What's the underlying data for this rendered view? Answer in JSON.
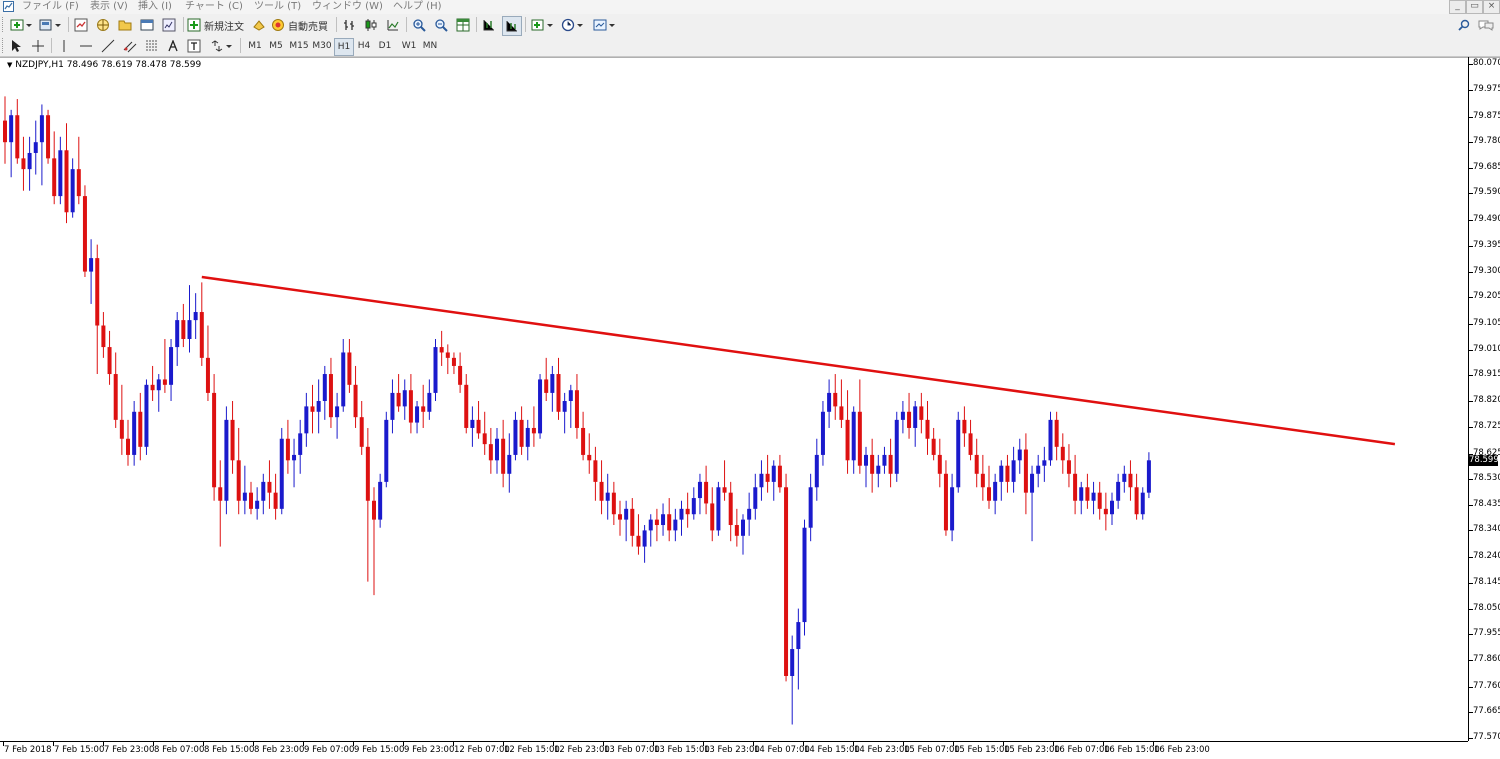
{
  "menu": {
    "items": [
      "ファイル (F)",
      "表示 (V)",
      "挿入 (I)",
      "チャート (C)",
      "ツール (T)",
      "ウィンドウ (W)",
      "ヘルプ (H)"
    ]
  },
  "toolbar": {
    "new_order_label": "新規注文",
    "auto_trading_label": "自動売買"
  },
  "timeframes": [
    "M1",
    "M5",
    "M15",
    "M30",
    "H1",
    "H4",
    "D1",
    "W1",
    "MN"
  ],
  "active_timeframe": "H1",
  "chart": {
    "symbol_info": "NZDJPY,H1  78.496 78.619 78.478 78.599",
    "current_price": "78.599",
    "price_levels": [
      "80.070",
      "79.975",
      "79.875",
      "79.780",
      "79.685",
      "79.590",
      "79.490",
      "79.395",
      "79.300",
      "79.205",
      "79.105",
      "79.010",
      "78.915",
      "78.820",
      "78.725",
      "78.625",
      "78.530",
      "78.435",
      "78.340",
      "78.240",
      "78.145",
      "78.050",
      "77.955",
      "77.860",
      "77.760",
      "77.665",
      "77.570"
    ],
    "time_labels": [
      "7 Feb 2018",
      "7 Feb 15:00",
      "7 Feb 23:00",
      "8 Feb 07:00",
      "8 Feb 15:00",
      "8 Feb 23:00",
      "9 Feb 07:00",
      "9 Feb 15:00",
      "9 Feb 23:00",
      "12 Feb 07:00",
      "12 Feb 15:00",
      "12 Feb 23:00",
      "13 Feb 07:00",
      "13 Feb 15:00",
      "13 Feb 23:00",
      "14 Feb 07:00",
      "14 Feb 15:00",
      "14 Feb 23:00",
      "15 Feb 07:00",
      "15 Feb 15:00",
      "15 Feb 23:00",
      "16 Feb 07:00",
      "16 Feb 15:00",
      "16 Feb 23:00"
    ],
    "colors": {
      "bull": "#1a1acc",
      "bear": "#dd1111",
      "trendline": "#e01010",
      "doji": "#22aa22"
    },
    "trendline": {
      "start": {
        "bar": 32,
        "price": 79.28
      },
      "end": {
        "bar": 226,
        "price": 78.66
      }
    },
    "ohlc": [
      [
        79.86,
        79.95,
        79.7,
        79.78
      ],
      [
        79.78,
        79.9,
        79.65,
        79.88
      ],
      [
        79.88,
        79.94,
        79.7,
        79.72
      ],
      [
        79.72,
        79.8,
        79.6,
        79.68
      ],
      [
        79.68,
        79.8,
        79.6,
        79.74
      ],
      [
        79.74,
        79.86,
        79.66,
        79.78
      ],
      [
        79.78,
        79.92,
        79.62,
        79.88
      ],
      [
        79.88,
        79.9,
        79.7,
        79.72
      ],
      [
        79.72,
        79.82,
        79.55,
        79.58
      ],
      [
        79.58,
        79.8,
        79.55,
        79.75
      ],
      [
        79.75,
        79.85,
        79.48,
        79.52
      ],
      [
        79.52,
        79.72,
        79.5,
        79.68
      ],
      [
        79.68,
        79.8,
        79.55,
        79.58
      ],
      [
        79.58,
        79.62,
        79.28,
        79.3
      ],
      [
        79.3,
        79.42,
        79.18,
        79.35
      ],
      [
        79.35,
        79.4,
        78.92,
        79.1
      ],
      [
        79.1,
        79.15,
        78.98,
        79.02
      ],
      [
        79.02,
        79.08,
        78.88,
        78.92
      ],
      [
        78.92,
        79.0,
        78.72,
        78.75
      ],
      [
        78.75,
        78.88,
        78.62,
        78.68
      ],
      [
        78.68,
        78.75,
        78.58,
        78.62
      ],
      [
        78.62,
        78.82,
        78.58,
        78.78
      ],
      [
        78.78,
        78.85,
        78.6,
        78.65
      ],
      [
        78.65,
        78.9,
        78.62,
        78.88
      ],
      [
        78.88,
        78.95,
        78.82,
        78.86
      ],
      [
        78.86,
        78.92,
        78.78,
        78.9
      ],
      [
        78.9,
        79.05,
        78.85,
        78.88
      ],
      [
        78.88,
        79.05,
        78.82,
        79.02
      ],
      [
        79.02,
        79.15,
        78.95,
        79.12
      ],
      [
        79.12,
        79.18,
        79.02,
        79.05
      ],
      [
        79.05,
        79.25,
        79.0,
        79.12
      ],
      [
        79.12,
        79.22,
        79.05,
        79.15
      ],
      [
        79.15,
        79.26,
        78.95,
        78.98
      ],
      [
        78.98,
        79.1,
        78.82,
        78.85
      ],
      [
        78.85,
        78.92,
        78.45,
        78.5
      ],
      [
        78.5,
        78.6,
        78.28,
        78.45
      ],
      [
        78.45,
        78.8,
        78.4,
        78.75
      ],
      [
        78.75,
        78.82,
        78.55,
        78.6
      ],
      [
        78.6,
        78.72,
        78.4,
        78.45
      ],
      [
        78.45,
        78.58,
        78.4,
        78.48
      ],
      [
        78.48,
        78.52,
        78.4,
        78.42
      ],
      [
        78.42,
        78.5,
        78.38,
        78.45
      ],
      [
        78.45,
        78.55,
        78.4,
        78.52
      ],
      [
        78.52,
        78.6,
        78.42,
        78.48
      ],
      [
        78.48,
        78.55,
        78.38,
        78.42
      ],
      [
        78.42,
        78.72,
        78.4,
        78.68
      ],
      [
        78.68,
        78.75,
        78.55,
        78.6
      ],
      [
        78.6,
        78.68,
        78.5,
        78.62
      ],
      [
        78.62,
        78.75,
        78.55,
        78.7
      ],
      [
        78.7,
        78.85,
        78.65,
        78.8
      ],
      [
        78.8,
        78.88,
        78.7,
        78.78
      ],
      [
        78.78,
        78.9,
        78.7,
        78.82
      ],
      [
        78.82,
        78.95,
        78.75,
        78.92
      ],
      [
        78.92,
        78.98,
        78.72,
        78.76
      ],
      [
        78.76,
        78.85,
        78.68,
        78.8
      ],
      [
        78.8,
        79.05,
        78.78,
        79.0
      ],
      [
        79.0,
        79.05,
        78.85,
        78.88
      ],
      [
        78.88,
        78.95,
        78.72,
        78.76
      ],
      [
        78.76,
        78.82,
        78.62,
        78.65
      ],
      [
        78.65,
        78.72,
        78.15,
        78.45
      ],
      [
        78.45,
        78.5,
        78.1,
        78.38
      ],
      [
        78.38,
        78.55,
        78.35,
        78.52
      ],
      [
        78.52,
        78.78,
        78.5,
        78.75
      ],
      [
        78.75,
        78.9,
        78.7,
        78.85
      ],
      [
        78.85,
        78.92,
        78.78,
        78.8
      ],
      [
        78.8,
        78.9,
        78.75,
        78.86
      ],
      [
        78.86,
        78.92,
        78.7,
        78.74
      ],
      [
        78.74,
        78.82,
        78.7,
        78.8
      ],
      [
        78.8,
        78.88,
        78.72,
        78.78
      ],
      [
        78.78,
        78.9,
        78.75,
        78.85
      ],
      [
        78.85,
        79.05,
        78.82,
        79.02
      ],
      [
        79.02,
        79.08,
        78.95,
        79.0
      ],
      [
        79.0,
        79.03,
        78.92,
        78.98
      ],
      [
        78.98,
        79.0,
        78.92,
        78.95
      ],
      [
        78.95,
        79.0,
        78.85,
        78.88
      ],
      [
        78.88,
        78.92,
        78.7,
        78.72
      ],
      [
        78.72,
        78.8,
        78.65,
        78.75
      ],
      [
        78.75,
        78.82,
        78.68,
        78.7
      ],
      [
        78.7,
        78.78,
        78.62,
        78.66
      ],
      [
        78.66,
        78.72,
        78.55,
        78.6
      ],
      [
        78.6,
        78.72,
        78.55,
        78.68
      ],
      [
        78.68,
        78.75,
        78.5,
        78.55
      ],
      [
        78.55,
        78.7,
        78.48,
        78.62
      ],
      [
        78.62,
        78.78,
        78.6,
        78.75
      ],
      [
        78.75,
        78.8,
        78.62,
        78.65
      ],
      [
        78.65,
        78.75,
        78.6,
        78.72
      ],
      [
        78.72,
        78.8,
        78.65,
        78.7
      ],
      [
        78.7,
        78.92,
        78.68,
        78.9
      ],
      [
        78.9,
        78.98,
        78.82,
        78.85
      ],
      [
        78.85,
        78.95,
        78.78,
        78.92
      ],
      [
        78.92,
        78.98,
        78.75,
        78.78
      ],
      [
        78.78,
        78.85,
        78.7,
        78.82
      ],
      [
        78.82,
        78.88,
        78.72,
        78.86
      ],
      [
        78.86,
        78.92,
        78.68,
        78.72
      ],
      [
        78.72,
        78.78,
        78.6,
        78.62
      ],
      [
        78.62,
        78.7,
        78.55,
        78.6
      ],
      [
        78.6,
        78.65,
        78.45,
        78.52
      ],
      [
        78.52,
        78.6,
        78.4,
        78.45
      ],
      [
        78.45,
        78.55,
        78.38,
        78.48
      ],
      [
        78.48,
        78.52,
        78.36,
        78.4
      ],
      [
        78.4,
        78.45,
        78.32,
        78.38
      ],
      [
        78.38,
        78.45,
        78.3,
        78.42
      ],
      [
        78.42,
        78.46,
        78.28,
        78.32
      ],
      [
        78.32,
        78.4,
        78.25,
        78.28
      ],
      [
        78.28,
        78.36,
        78.22,
        78.34
      ],
      [
        78.34,
        78.4,
        78.28,
        78.38
      ],
      [
        78.38,
        78.42,
        78.3,
        78.36
      ],
      [
        78.36,
        78.44,
        78.32,
        78.4
      ],
      [
        78.4,
        78.46,
        78.3,
        78.34
      ],
      [
        78.34,
        78.42,
        78.3,
        78.38
      ],
      [
        78.38,
        78.45,
        78.32,
        78.42
      ],
      [
        78.42,
        78.48,
        78.35,
        78.4
      ],
      [
        78.4,
        78.5,
        78.38,
        78.46
      ],
      [
        78.46,
        78.55,
        78.4,
        78.52
      ],
      [
        78.52,
        78.58,
        78.4,
        78.44
      ],
      [
        78.44,
        78.5,
        78.3,
        78.34
      ],
      [
        78.34,
        78.52,
        78.32,
        78.5
      ],
      [
        78.5,
        78.6,
        78.45,
        78.48
      ],
      [
        78.48,
        78.52,
        78.3,
        78.36
      ],
      [
        78.36,
        78.42,
        78.28,
        78.32
      ],
      [
        78.32,
        78.4,
        78.25,
        78.38
      ],
      [
        78.38,
        78.48,
        78.32,
        78.42
      ],
      [
        78.42,
        78.55,
        78.38,
        78.5
      ],
      [
        78.5,
        78.6,
        78.45,
        78.55
      ],
      [
        78.55,
        78.62,
        78.48,
        78.52
      ],
      [
        78.52,
        78.6,
        78.45,
        78.58
      ],
      [
        78.58,
        78.62,
        78.48,
        78.5
      ],
      [
        78.5,
        78.55,
        77.78,
        77.8
      ],
      [
        77.8,
        77.95,
        77.62,
        77.9
      ],
      [
        77.9,
        78.05,
        77.75,
        78.0
      ],
      [
        78.0,
        78.38,
        77.95,
        78.35
      ],
      [
        78.35,
        78.55,
        78.3,
        78.5
      ],
      [
        78.5,
        78.68,
        78.45,
        78.62
      ],
      [
        78.62,
        78.82,
        78.58,
        78.78
      ],
      [
        78.78,
        78.9,
        78.72,
        78.85
      ],
      [
        78.85,
        78.92,
        78.75,
        78.8
      ],
      [
        78.8,
        78.9,
        78.72,
        78.75
      ],
      [
        78.75,
        78.86,
        78.55,
        78.6
      ],
      [
        78.6,
        78.8,
        78.55,
        78.78
      ],
      [
        78.78,
        78.9,
        78.55,
        78.58
      ],
      [
        78.58,
        78.65,
        78.5,
        78.62
      ],
      [
        78.62,
        78.68,
        78.48,
        78.55
      ],
      [
        78.55,
        78.62,
        78.5,
        78.58
      ],
      [
        78.58,
        78.65,
        78.55,
        78.62
      ],
      [
        78.62,
        78.68,
        78.5,
        78.55
      ],
      [
        78.55,
        78.78,
        78.52,
        78.75
      ],
      [
        78.75,
        78.82,
        78.7,
        78.78
      ],
      [
        78.78,
        78.85,
        78.68,
        78.72
      ],
      [
        78.72,
        78.82,
        78.65,
        78.8
      ],
      [
        78.8,
        78.85,
        78.7,
        78.75
      ],
      [
        78.75,
        78.82,
        78.62,
        78.68
      ],
      [
        78.68,
        78.72,
        78.6,
        78.62
      ],
      [
        78.62,
        78.68,
        78.5,
        78.55
      ],
      [
        78.55,
        78.6,
        78.32,
        78.34
      ],
      [
        78.34,
        78.55,
        78.3,
        78.5
      ],
      [
        78.5,
        78.78,
        78.48,
        78.75
      ],
      [
        78.75,
        78.8,
        78.65,
        78.7
      ],
      [
        78.7,
        78.75,
        78.6,
        78.62
      ],
      [
        78.62,
        78.68,
        78.5,
        78.55
      ],
      [
        78.55,
        78.62,
        78.45,
        78.5
      ],
      [
        78.5,
        78.58,
        78.42,
        78.45
      ],
      [
        78.45,
        78.55,
        78.4,
        78.52
      ],
      [
        78.52,
        78.6,
        78.45,
        78.58
      ],
      [
        78.58,
        78.62,
        78.48,
        78.52
      ],
      [
        78.52,
        78.65,
        78.48,
        78.6
      ],
      [
        78.6,
        78.68,
        78.55,
        78.64
      ],
      [
        78.64,
        78.7,
        78.4,
        78.48
      ],
      [
        78.48,
        78.58,
        78.3,
        78.55
      ],
      [
        78.55,
        78.62,
        78.5,
        78.58
      ],
      [
        78.58,
        78.65,
        78.52,
        78.6
      ],
      [
        78.6,
        78.78,
        78.58,
        78.75
      ],
      [
        78.75,
        78.78,
        78.6,
        78.65
      ],
      [
        78.65,
        78.7,
        78.55,
        78.6
      ],
      [
        78.6,
        78.66,
        78.5,
        78.55
      ],
      [
        78.55,
        78.62,
        78.4,
        78.45
      ],
      [
        78.45,
        78.52,
        78.4,
        78.5
      ],
      [
        78.5,
        78.55,
        78.42,
        78.45
      ],
      [
        78.45,
        78.52,
        78.4,
        78.48
      ],
      [
        78.48,
        78.52,
        78.38,
        78.42
      ],
      [
        78.42,
        78.48,
        78.34,
        78.4
      ],
      [
        78.4,
        78.48,
        78.36,
        78.45
      ],
      [
        78.45,
        78.55,
        78.42,
        78.52
      ],
      [
        78.52,
        78.58,
        78.48,
        78.55
      ],
      [
        78.55,
        78.6,
        78.45,
        78.5
      ],
      [
        78.5,
        78.55,
        78.38,
        78.4
      ],
      [
        78.4,
        78.5,
        78.38,
        78.48
      ],
      [
        78.48,
        78.63,
        78.46,
        78.6
      ]
    ]
  }
}
